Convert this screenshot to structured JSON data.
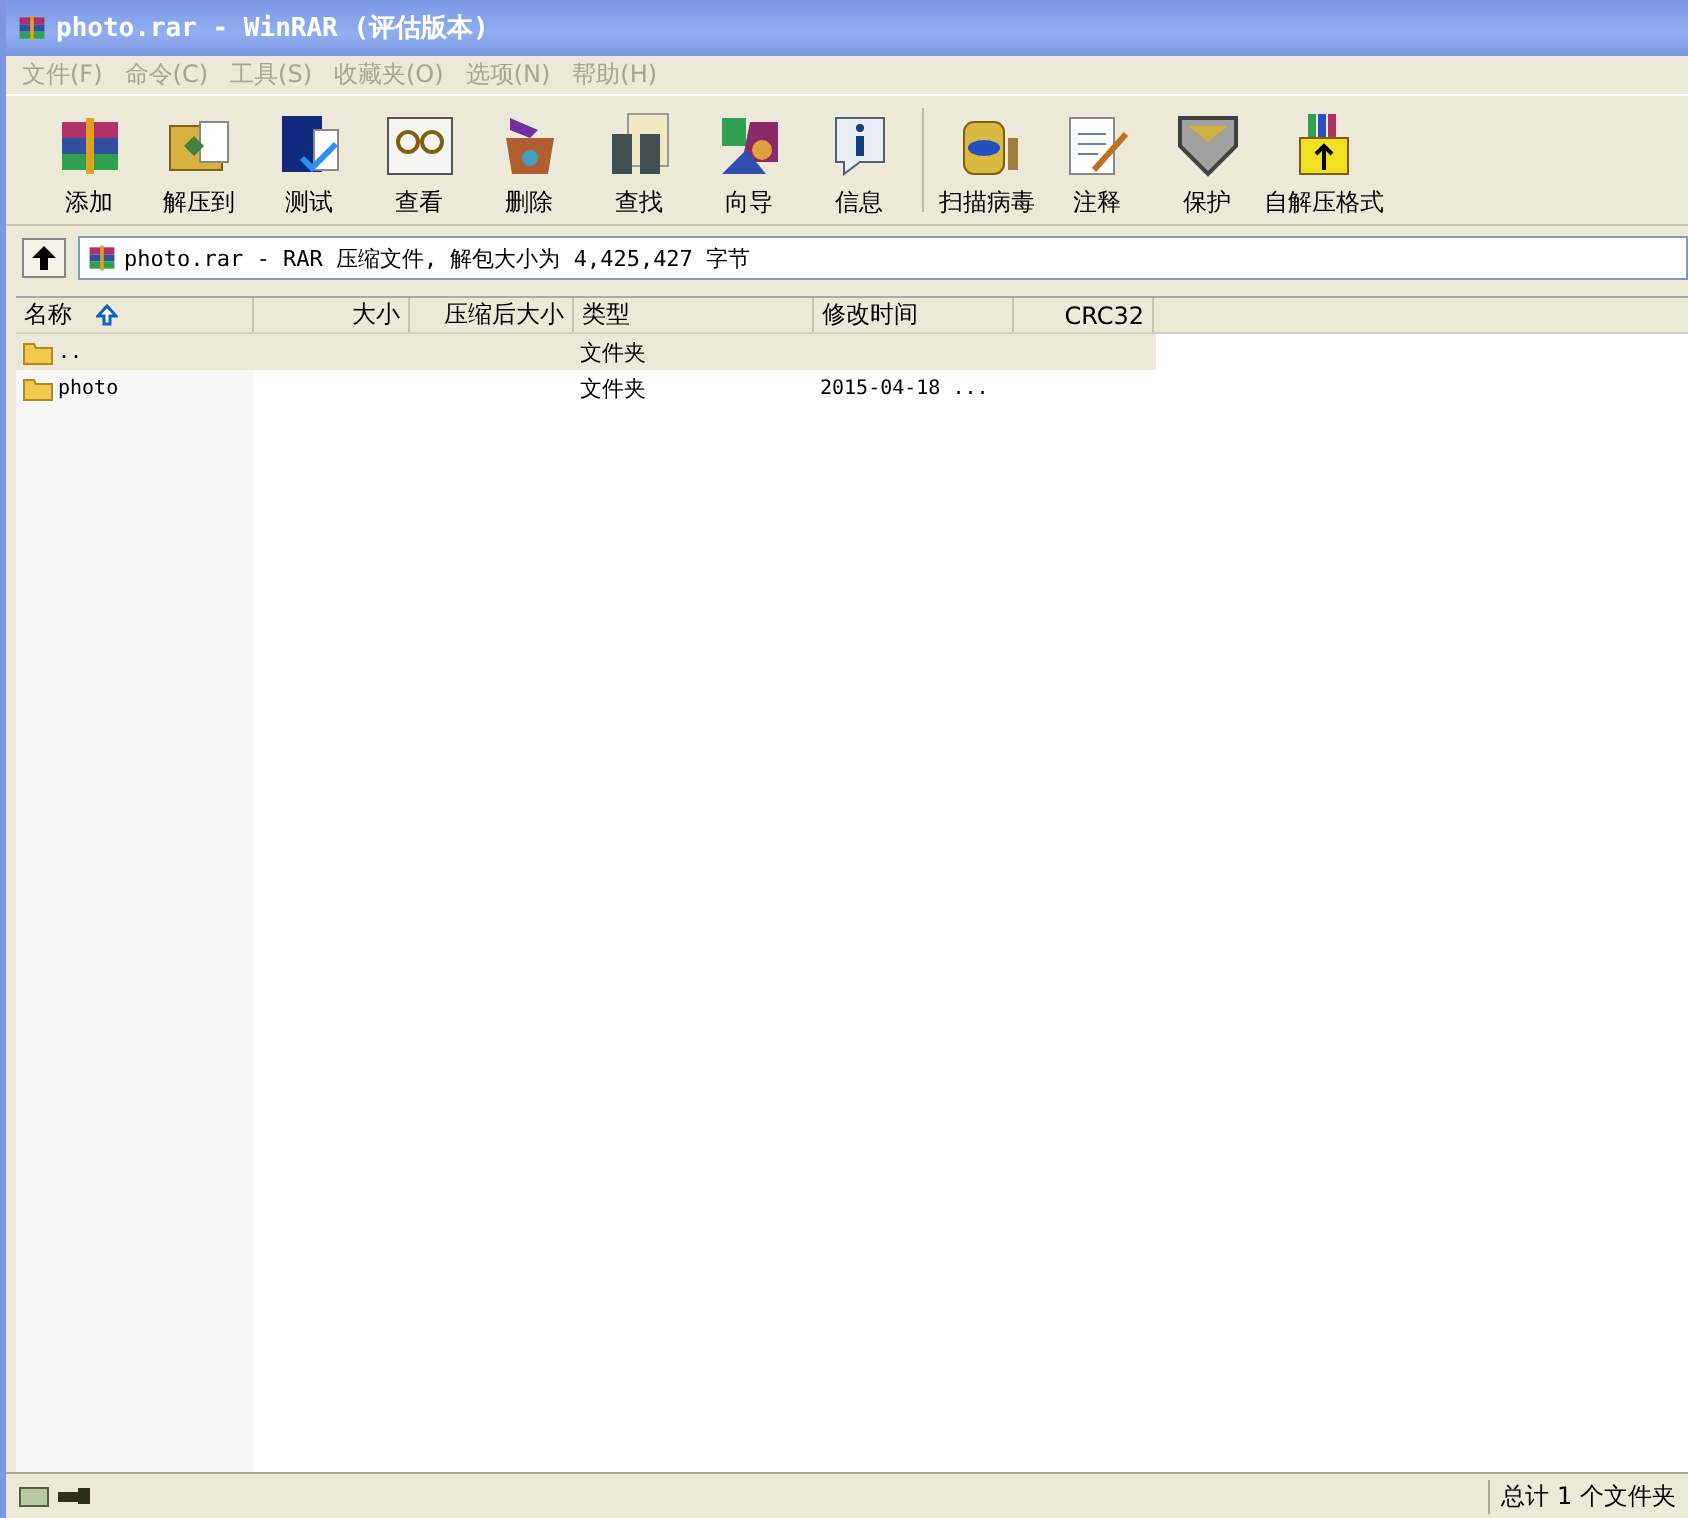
{
  "window": {
    "title": "photo.rar - WinRAR (评估版本)"
  },
  "menu": [
    {
      "label": "文件(F)",
      "disabled": true
    },
    {
      "label": "命令(C)",
      "disabled": true
    },
    {
      "label": "工具(S)",
      "disabled": true
    },
    {
      "label": "收藏夹(O)",
      "disabled": true
    },
    {
      "label": "选项(N)",
      "disabled": true
    },
    {
      "label": "帮助(H)",
      "disabled": true
    }
  ],
  "toolbar": [
    {
      "label": "添加"
    },
    {
      "label": "解压到"
    },
    {
      "label": "测试"
    },
    {
      "label": "查看"
    },
    {
      "label": "删除"
    },
    {
      "label": "查找"
    },
    {
      "label": "向导"
    },
    {
      "label": "信息"
    },
    {
      "label": "扫描病毒"
    },
    {
      "label": "注释"
    },
    {
      "label": "保护"
    },
    {
      "label": "自解压格式"
    }
  ],
  "address": {
    "value": "photo.rar - RAR 压缩文件, 解包大小为 4,425,427 字节"
  },
  "table": {
    "columns": [
      {
        "label": "名称",
        "sorted": true
      },
      {
        "label": "大小",
        "sorted": false
      },
      {
        "label": "压缩后大小",
        "sorted": false
      },
      {
        "label": "类型",
        "sorted": false
      },
      {
        "label": "修改时间",
        "sorted": false
      },
      {
        "label": "CRC32",
        "sorted": false
      }
    ],
    "rows": [
      {
        "name": "..",
        "size": "",
        "packed": "",
        "type": "文件夹",
        "modified": "",
        "selected": true
      },
      {
        "name": "photo",
        "type": "文件夹",
        "modified": "2015-04-18 ...",
        "selected": false
      }
    ]
  },
  "status_bar": {
    "text": "总计 1 个文件夹"
  }
}
